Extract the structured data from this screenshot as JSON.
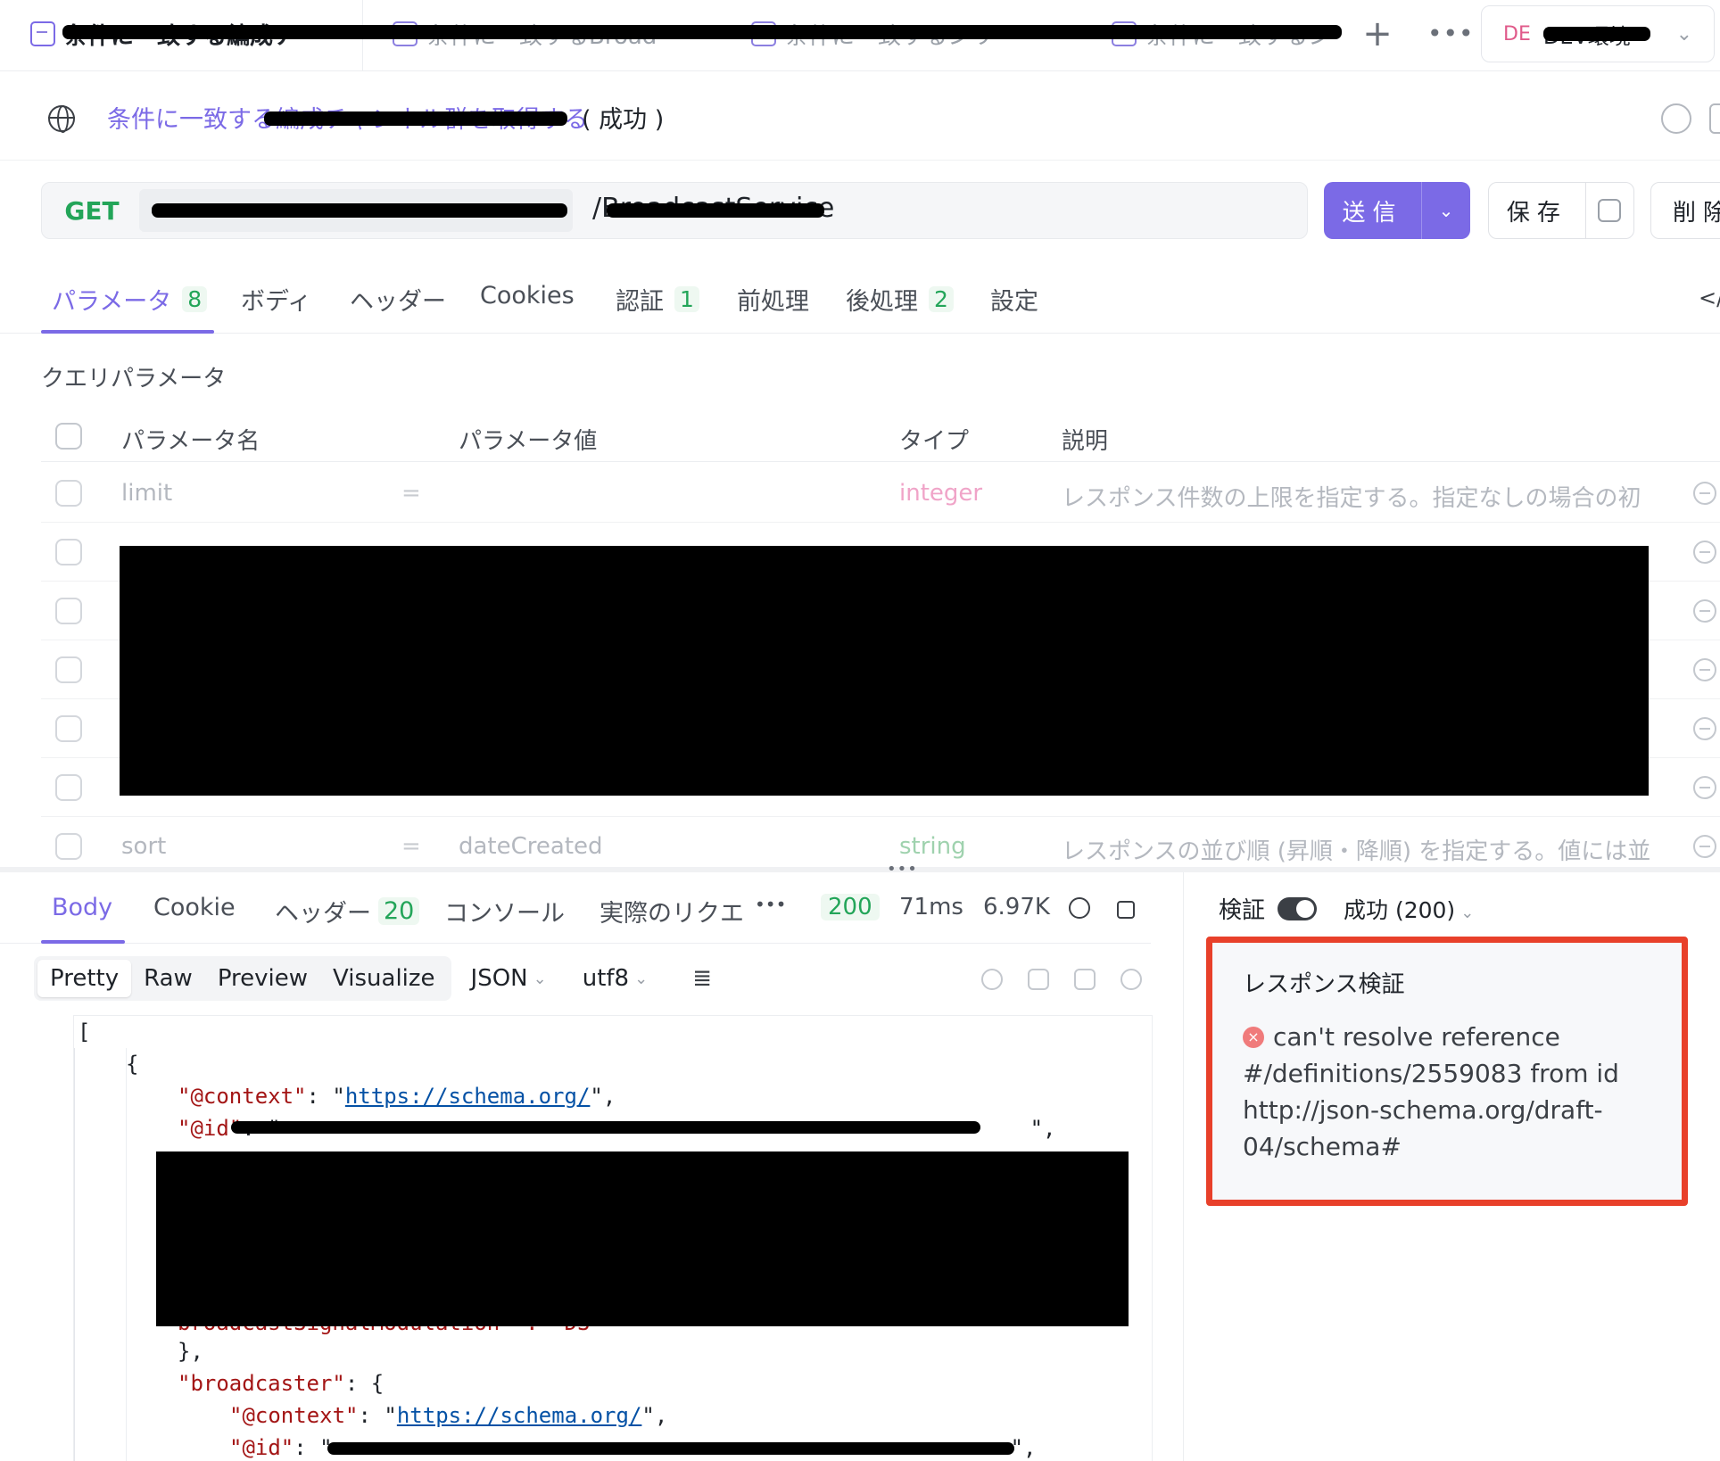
{
  "tabs": {
    "items": [
      {
        "label": "条件に一致する編成チ"
      },
      {
        "label": "条件に一致するBroad"
      },
      {
        "label": "条件に一致するシリ"
      },
      {
        "label": "条件に一致するシ"
      }
    ],
    "plus": "+",
    "more": "•••"
  },
  "env": {
    "badge": "DE",
    "label": "DEV環境",
    "chevron": "⌄"
  },
  "title": {
    "link": "条件に一致する編成チャンネル群を取得する",
    "status": "( 成功 )"
  },
  "request": {
    "method": "GET",
    "path": "/BroadcastService",
    "send_label": "送信",
    "save_label": "保存",
    "delete_label": "削除",
    "chevron": "⌄"
  },
  "req_tabs": [
    {
      "label": "パラメータ",
      "count": "8"
    },
    {
      "label": "ボディ",
      "count": ""
    },
    {
      "label": "ヘッダー",
      "count": ""
    },
    {
      "label": "Cookies",
      "count": ""
    },
    {
      "label": "認証",
      "count": "1"
    },
    {
      "label": "前処理",
      "count": ""
    },
    {
      "label": "後処理",
      "count": "2"
    },
    {
      "label": "設定",
      "count": ""
    }
  ],
  "code_toggle": "</>",
  "params": {
    "section": "クエリパラメータ",
    "headers": {
      "name": "パラメータ名",
      "value": "パラメータ値",
      "type": "タイプ",
      "desc": "説明"
    },
    "rows": [
      {
        "name": "limit",
        "eq": "=",
        "value": "",
        "type": "integer",
        "desc": "レスポンス件数の上限を指定する。指定なしの場合の初"
      },
      {
        "name": "sort",
        "eq": "=",
        "value": "dateCreated",
        "type": "string",
        "desc": "レスポンスの並び順 (昇順・降順) を指定する。値には並"
      }
    ]
  },
  "splitter": "•••",
  "response": {
    "tabs": [
      {
        "label": "Body",
        "count": ""
      },
      {
        "label": "Cookie",
        "count": ""
      },
      {
        "label": "ヘッダー",
        "count": "20"
      },
      {
        "label": "コンソール",
        "count": ""
      },
      {
        "label": "実際のリクエ",
        "count": ""
      }
    ],
    "more": "•••",
    "status_code": "200",
    "time": "71ms",
    "size": "6.97K",
    "formats": [
      "Pretty",
      "Raw",
      "Preview",
      "Visualize"
    ],
    "active_format": "Pretty",
    "lang": "JSON",
    "encoding": "utf8",
    "wrap": "≣",
    "code": {
      "open_bracket": "[",
      "open_brace": "{",
      "context_key": "\"@context\"",
      "context_val": "https://schema.org/",
      "id_key": "\"@id\"",
      "partial_key": "broadcastSignalModulation",
      "partial_val": "\"DS\"",
      "close_brace": "},",
      "broadcaster_key": "\"broadcaster\"",
      "b_context_key": "\"@context\"",
      "b_context_val": "https://schema.org/",
      "b_id_key": "\"@id\""
    }
  },
  "validation": {
    "label": "検証",
    "status": "成功 (200)",
    "card_title": "レスポンス検証",
    "error_icon": "×",
    "message": "can't resolve reference #/definitions/2559083 from id http://json-schema.org/draft-04/schema#"
  }
}
